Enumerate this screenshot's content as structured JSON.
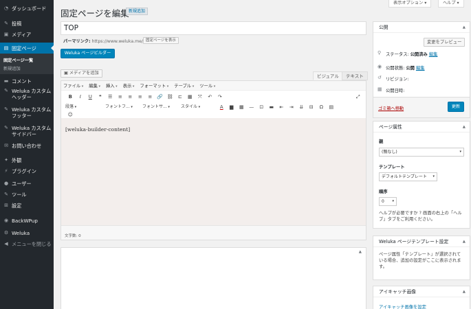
{
  "sidebar": {
    "items": [
      {
        "icon": "dashboard-icon",
        "glyph": "◔",
        "label": "ダッシュボード"
      },
      {
        "icon": "pin-icon",
        "glyph": "✎",
        "label": "投稿"
      },
      {
        "icon": "media-icon",
        "glyph": "▣",
        "label": "メディア"
      },
      {
        "icon": "page-icon",
        "glyph": "▤",
        "label": "固定ページ"
      },
      {
        "icon": "comment-icon",
        "glyph": "▬",
        "label": "コメント"
      },
      {
        "icon": "pin-icon",
        "glyph": "✎",
        "label": "Weluka カスタムヘッダー"
      },
      {
        "icon": "pin-icon",
        "glyph": "✎",
        "label": "Weluka カスタムフッター"
      },
      {
        "icon": "pin-icon",
        "glyph": "✎",
        "label": "Weluka カスタムサイドバー"
      },
      {
        "icon": "mail-icon",
        "glyph": "✉",
        "label": "お問い合わせ"
      },
      {
        "icon": "appearance-icon",
        "glyph": "✦",
        "label": "外観"
      },
      {
        "icon": "plugin-icon",
        "glyph": "⚡",
        "label": "プラグイン"
      },
      {
        "icon": "user-icon",
        "glyph": "●",
        "label": "ユーザー"
      },
      {
        "icon": "tool-icon",
        "glyph": "✎",
        "label": "ツール"
      },
      {
        "icon": "settings-icon",
        "glyph": "⊞",
        "label": "設定"
      },
      {
        "icon": "backup-icon",
        "glyph": "◉",
        "label": "BackWPup"
      },
      {
        "icon": "gear-icon",
        "glyph": "⚙",
        "label": "Weluka"
      },
      {
        "icon": "collapse-icon",
        "glyph": "◀",
        "label": "メニューを閉じる"
      }
    ],
    "submenu": [
      "固定ページ一覧",
      "新規追加"
    ]
  },
  "header": {
    "title": "固定ページを編集",
    "new_button": "新規追加",
    "screen_options": "表示オプション ▾",
    "help": "ヘルプ ▾"
  },
  "editor": {
    "title_value": "TOP",
    "permalink_label": "パーマリンク:",
    "permalink_url": "https://www.weluka.me/",
    "permalink_button": "固定ページを表示",
    "builder_button": "Weluka ページビルダー",
    "media_button": "メディアを追加",
    "tab_visual": "ビジュアル",
    "tab_text": "テキスト",
    "menus": [
      "ファイル",
      "編集",
      "挿入",
      "表示",
      "フォーマット",
      "テーブル",
      "ツール"
    ],
    "row1_icons": [
      "B",
      "I",
      "U",
      "❝",
      "☰",
      "≡",
      "≡",
      "≡",
      "≡",
      "🔗",
      "⛓",
      "⊏",
      "▦",
      "⤧",
      "↶",
      "↷"
    ],
    "row2_selects": [
      "段落",
      "フォントフ...",
      "フォントサ...",
      "スタイル"
    ],
    "row2_icons": [
      "A",
      "▆",
      "▦",
      "—",
      "⊡",
      "▬",
      "⇤",
      "⇥",
      "⇊",
      "⊟",
      "Ω",
      "▤"
    ],
    "emoji": "☺",
    "content": "[weluka-builder-content]",
    "word_count": "文字数: 0"
  },
  "publish": {
    "title": "公開",
    "preview_button": "変更をプレビュー",
    "status_label": "ステータス:",
    "status_value": "公開済み",
    "status_edit": "編集",
    "visibility_label": "公開状態:",
    "visibility_value": "公開",
    "visibility_edit": "編集",
    "revision_label": "リビジョン:",
    "date_label": "公開日時:",
    "trash": "ゴミ箱へ移動",
    "update_button": "更新"
  },
  "page_attributes": {
    "title": "ページ属性",
    "parent_label": "親",
    "parent_value": "(親なし)",
    "template_label": "テンプレート",
    "template_value": "デフォルトテンプレート",
    "order_label": "順序",
    "order_value": "0",
    "help_text": "ヘルプが必要ですか ? 画面の右上の「ヘルプ」タブをご利用ください。"
  },
  "weluka_template": {
    "title": "Weluka ページテンプレート設定",
    "text": "ページ属性「テンプレート」が選択されている場合、追加の設定がここに表示されます。"
  },
  "featured_image": {
    "title": "アイキャッチ画像",
    "link": "アイキャッチ画像を設定"
  },
  "colors": {
    "accent": "#0073aa",
    "sidebar": "#23282d",
    "trash": "#a00"
  }
}
